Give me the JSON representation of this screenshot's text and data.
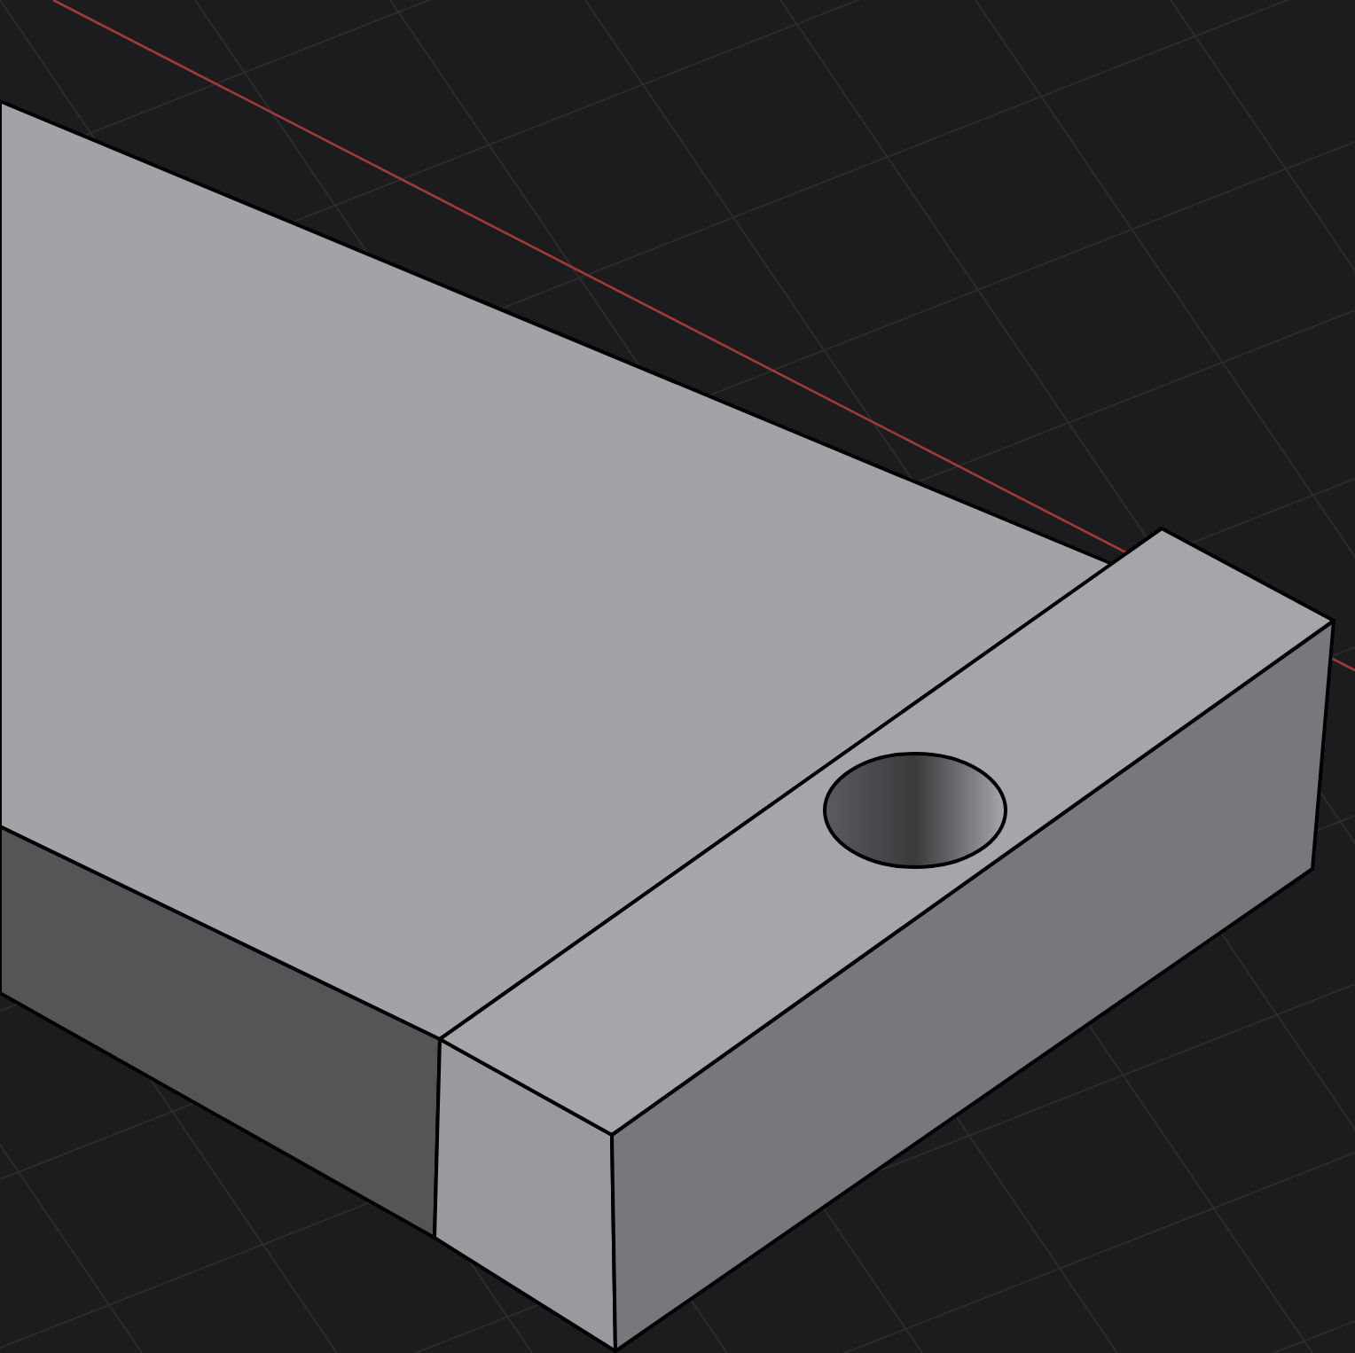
{
  "viewport": {
    "grid_visible": true,
    "axis_visible": true
  }
}
